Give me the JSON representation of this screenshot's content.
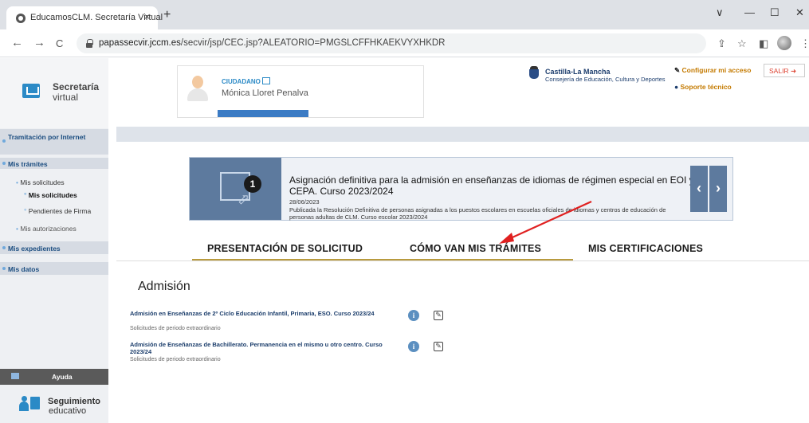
{
  "browser": {
    "tab_title": "EducamosCLM. Secretaría Virtual",
    "tab_close": "×",
    "new_tab": "+",
    "url_host": "papassecvir.jccm.es",
    "url_path": "/secvir/jsp/CEC.jsp?ALEATORIO=PMGSLCFFHKAEKVYXHKDR",
    "nav_back": "←",
    "nav_forward": "→",
    "nav_reload": "C",
    "win_min": "—",
    "win_max": "☐",
    "win_close": "✕",
    "win_chevron": "∨",
    "share_icon": "⇪",
    "star_icon": "☆",
    "sidebar_icon": "◧",
    "menu_icon": "⋮"
  },
  "sidebar": {
    "logo_title": "Secretaría",
    "logo_sub": "virtual",
    "tramitacion": "Tramitación por Internet",
    "mis_tramites": "Mis trámites",
    "mis_solicitudes_group": "Mis solicitudes",
    "mis_solicitudes": "Mis solicitudes",
    "pendientes_firma": "Pendientes de Firma",
    "mis_autorizaciones": "Mis autorizaciones",
    "mis_expedientes": "Mis expedientes",
    "mis_datos": "Mis datos",
    "ayuda": "Ayuda",
    "seguimiento_title": "Seguimiento",
    "seguimiento_sub": "educativo"
  },
  "header": {
    "role": "CIUDADANO",
    "user_name": "Mónica Lloret Penalva",
    "org_title": "Castilla-La Mancha",
    "org_sub": "Consejería de Educación, Cultura y Deportes",
    "configurar": "Configurar mi acceso",
    "soporte": "Soporte técnico",
    "salir": "SALIR"
  },
  "banner": {
    "number": "1",
    "title": "Asignación definitiva para la admisión en enseñanzas de idiomas de régimen especial en EOI y CEPA. Curso 2023/2024",
    "date": "28/06/2023",
    "description": "Publicada la Resolución Definitiva de personas asignadas a los puestos escolares en escuelas oficiales de idiomas y centros de educación de personas adultas de CLM. Curso escolar 2023/2024",
    "prev": "‹",
    "next": "›"
  },
  "tabs": {
    "presentacion": "PRESENTACIÓN DE SOLICITUD",
    "como_van": "CÓMO VAN MIS TRÁMITES",
    "certificaciones": "MIS CERTIFICACIONES"
  },
  "content": {
    "section_title": "Admisión",
    "rows": [
      {
        "title": "Admisión en Enseñanzas de 2º Ciclo Educación Infantil, Primaria, ESO. Curso 2023/24",
        "subtitle": "Solicitudes de periodo extraordinario"
      },
      {
        "title": "Admisión de Enseñanzas de Bachillerato. Permanencia en el mismo u otro centro. Curso 2023/24",
        "subtitle": "Solicitudes de periodo extraordinario"
      }
    ],
    "info_glyph": "i",
    "edit_glyph": "✎"
  },
  "colors": {
    "accent": "#2b8ac6",
    "tab_underline": "#b89a3e",
    "annotation_arrow": "#e02020"
  }
}
